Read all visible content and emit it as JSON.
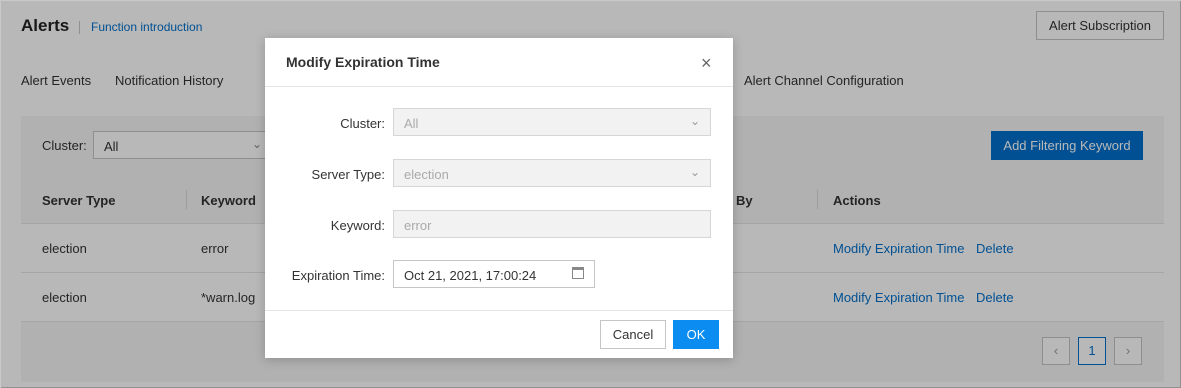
{
  "page": {
    "title": "Alerts",
    "function_intro": "Function introduction",
    "subscribe_button": "Alert Subscription"
  },
  "tabs": [
    {
      "label": "Alert Events"
    },
    {
      "label": "Notification History"
    },
    {
      "label": "Alert Channel Configuration"
    }
  ],
  "filter": {
    "cluster_label": "Cluster:",
    "cluster_value": "All",
    "add_keyword_button": "Add Filtering Keyword"
  },
  "table": {
    "headers": [
      "Server Type",
      "Keyword",
      "By",
      "Actions"
    ],
    "rows": [
      {
        "server_type": "election",
        "keyword": "error",
        "modify": "Modify Expiration Time",
        "delete": "Delete"
      },
      {
        "server_type": "election",
        "keyword": "*warn.log",
        "modify": "Modify Expiration Time",
        "delete": "Delete"
      }
    ]
  },
  "pagination": {
    "prev": "‹",
    "current": "1",
    "next": "›"
  },
  "modal": {
    "title": "Modify Expiration Time",
    "close": "×",
    "fields": {
      "cluster": {
        "label": "Cluster:",
        "value": "All"
      },
      "server_type": {
        "label": "Server Type:",
        "value": "election"
      },
      "keyword": {
        "label": "Keyword:",
        "value": "error"
      },
      "expiration": {
        "label": "Expiration Time:",
        "value": "Oct 21, 2021, 17:00:24"
      }
    },
    "cancel_button": "Cancel",
    "ok_button": "OK"
  },
  "colors": {
    "accent": "#0070cc",
    "ok_button": "#0a8cf0"
  }
}
